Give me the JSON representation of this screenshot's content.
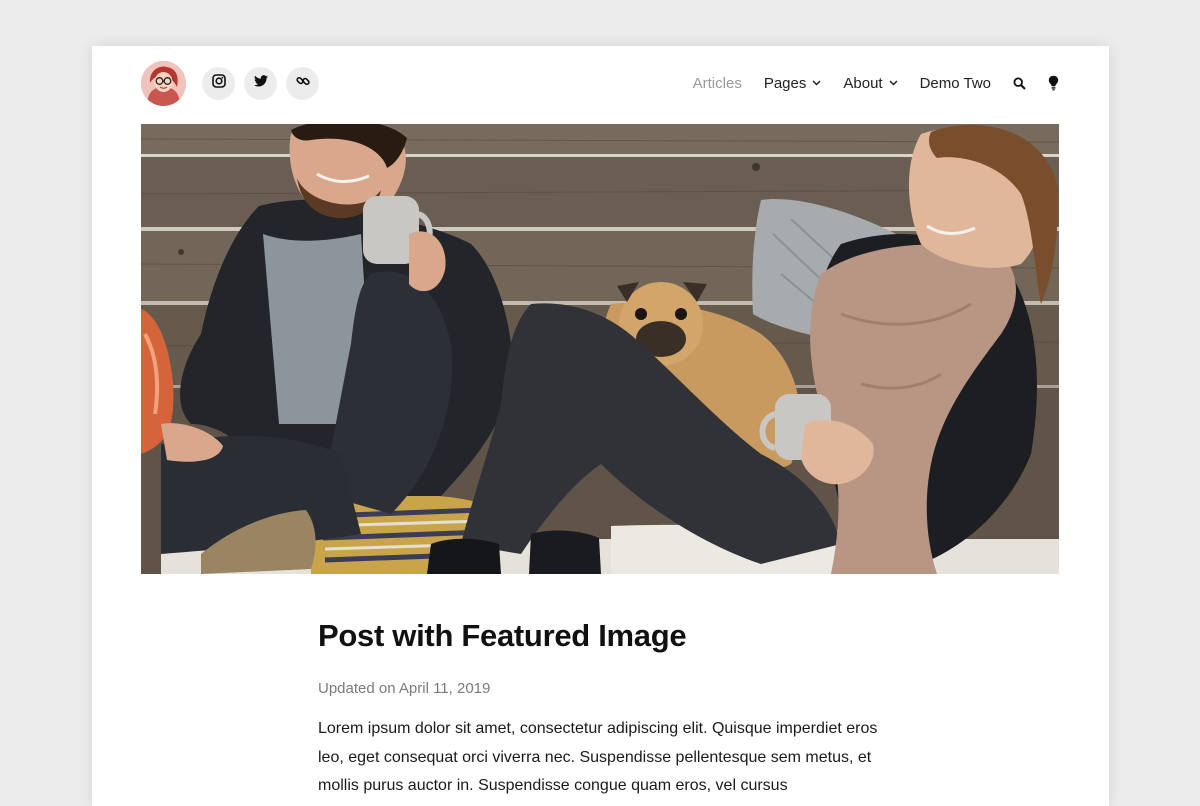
{
  "header": {
    "avatar_alt": "author avatar",
    "social": [
      {
        "icon": "instagram-icon"
      },
      {
        "icon": "twitter-icon"
      },
      {
        "icon": "link-icon"
      }
    ],
    "nav": [
      {
        "label": "Articles",
        "active": true
      },
      {
        "label": "Pages",
        "has_dropdown": true
      },
      {
        "label": "About",
        "has_dropdown": true
      },
      {
        "label": "Demo Two"
      }
    ],
    "search_icon": "search-icon",
    "theme_icon": "lightbulb-icon"
  },
  "hero": {
    "alt": "Two people with a pug drinking coffee on a wooden bench"
  },
  "post": {
    "title": "Post with Featured Image",
    "meta": "Updated on April 11, 2019",
    "body": "Lorem ipsum dolor sit amet, consectetur adipiscing elit. Quisque imperdiet eros leo, eget consequat orci viverra nec. Suspendisse pellentesque sem metus, et mollis purus auctor in. Suspendisse congue quam eros, vel cursus"
  },
  "colors": {
    "page_bg": "#ececec",
    "card_bg": "#ffffff",
    "nav_active": "#9a9a9a",
    "meta_text": "#7a7a7a",
    "icon_button_bg": "#ececec"
  }
}
